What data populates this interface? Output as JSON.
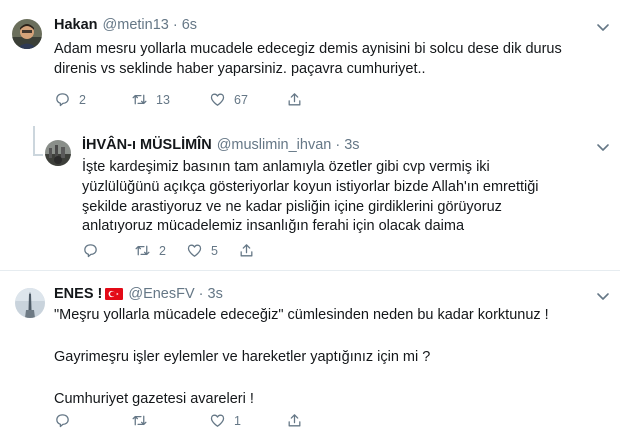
{
  "tweets": [
    {
      "name": "Hakan",
      "handle": "@metin13",
      "separator": "·",
      "time": "6s",
      "text": "Adam mesru yollarla mucadele edecegiz demis aynisini bi solcu dese dik durus\ndirenis vs seklinde haber yaparsiniz. paçavra cumhuriyet..",
      "replies": "2",
      "retweets": "13",
      "likes": "67"
    },
    {
      "name": "İHVÂN-ı MÜSLİMÎN",
      "handle": "@muslimin_ihvan",
      "separator": "·",
      "time": "3s",
      "text": "İşte kardeşimiz basının tam anlamıyla özetler gibi cvp vermiş iki\nyüzlülüğünü açıkça gösteriyorlar koyun istiyorlar bizde Allah'ın emrettiği\nşekilde arastiyoruz ve ne kadar pisliğin içine girdiklerini görüyoruz\nanlatıyoruz mücadelemiz insanlığın ferahi için olacak daima",
      "replies": "",
      "retweets": "2",
      "likes": "5"
    },
    {
      "name": "ENES !",
      "handle": "@EnesFV",
      "separator": "·",
      "time": "3s",
      "text": "\"Meşru yollarla mücadele edeceğiz\" cümlesinden neden bu kadar korktunuz !\n\nGayrimeşru işler eylemler ve hareketler yaptığınız için mi ?\n\n Cumhuriyet gazetesi avareleri !",
      "replies": "",
      "retweets": "",
      "likes": "1"
    }
  ],
  "colors": {
    "text": "#14171a",
    "muted": "#657786",
    "divider": "#e6ecf0",
    "flag_red": "#e30a17"
  },
  "icons": [
    "reply-icon",
    "retweet-icon",
    "like-icon",
    "share-icon",
    "chevron-down-icon",
    "turkey-flag-icon"
  ]
}
